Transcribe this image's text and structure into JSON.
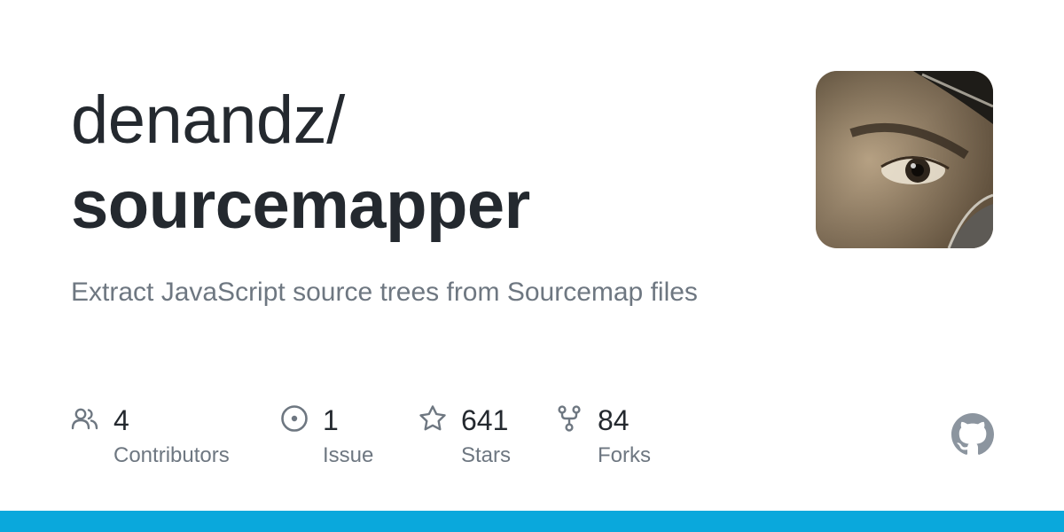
{
  "repository": {
    "owner": "denandz/",
    "name": "sourcemapper",
    "description": "Extract JavaScript source trees from Sourcemap files"
  },
  "stats": [
    {
      "count": "4",
      "label": "Contributors",
      "icon": "people-icon"
    },
    {
      "count": "1",
      "label": "Issue",
      "icon": "issue-opened-icon"
    },
    {
      "count": "641",
      "label": "Stars",
      "icon": "star-icon"
    },
    {
      "count": "84",
      "label": "Forks",
      "icon": "repo-forked-icon"
    }
  ],
  "colors": {
    "title": "#24292f",
    "muted": "#6e7781",
    "bottom_bar": "#0aa8dc"
  }
}
